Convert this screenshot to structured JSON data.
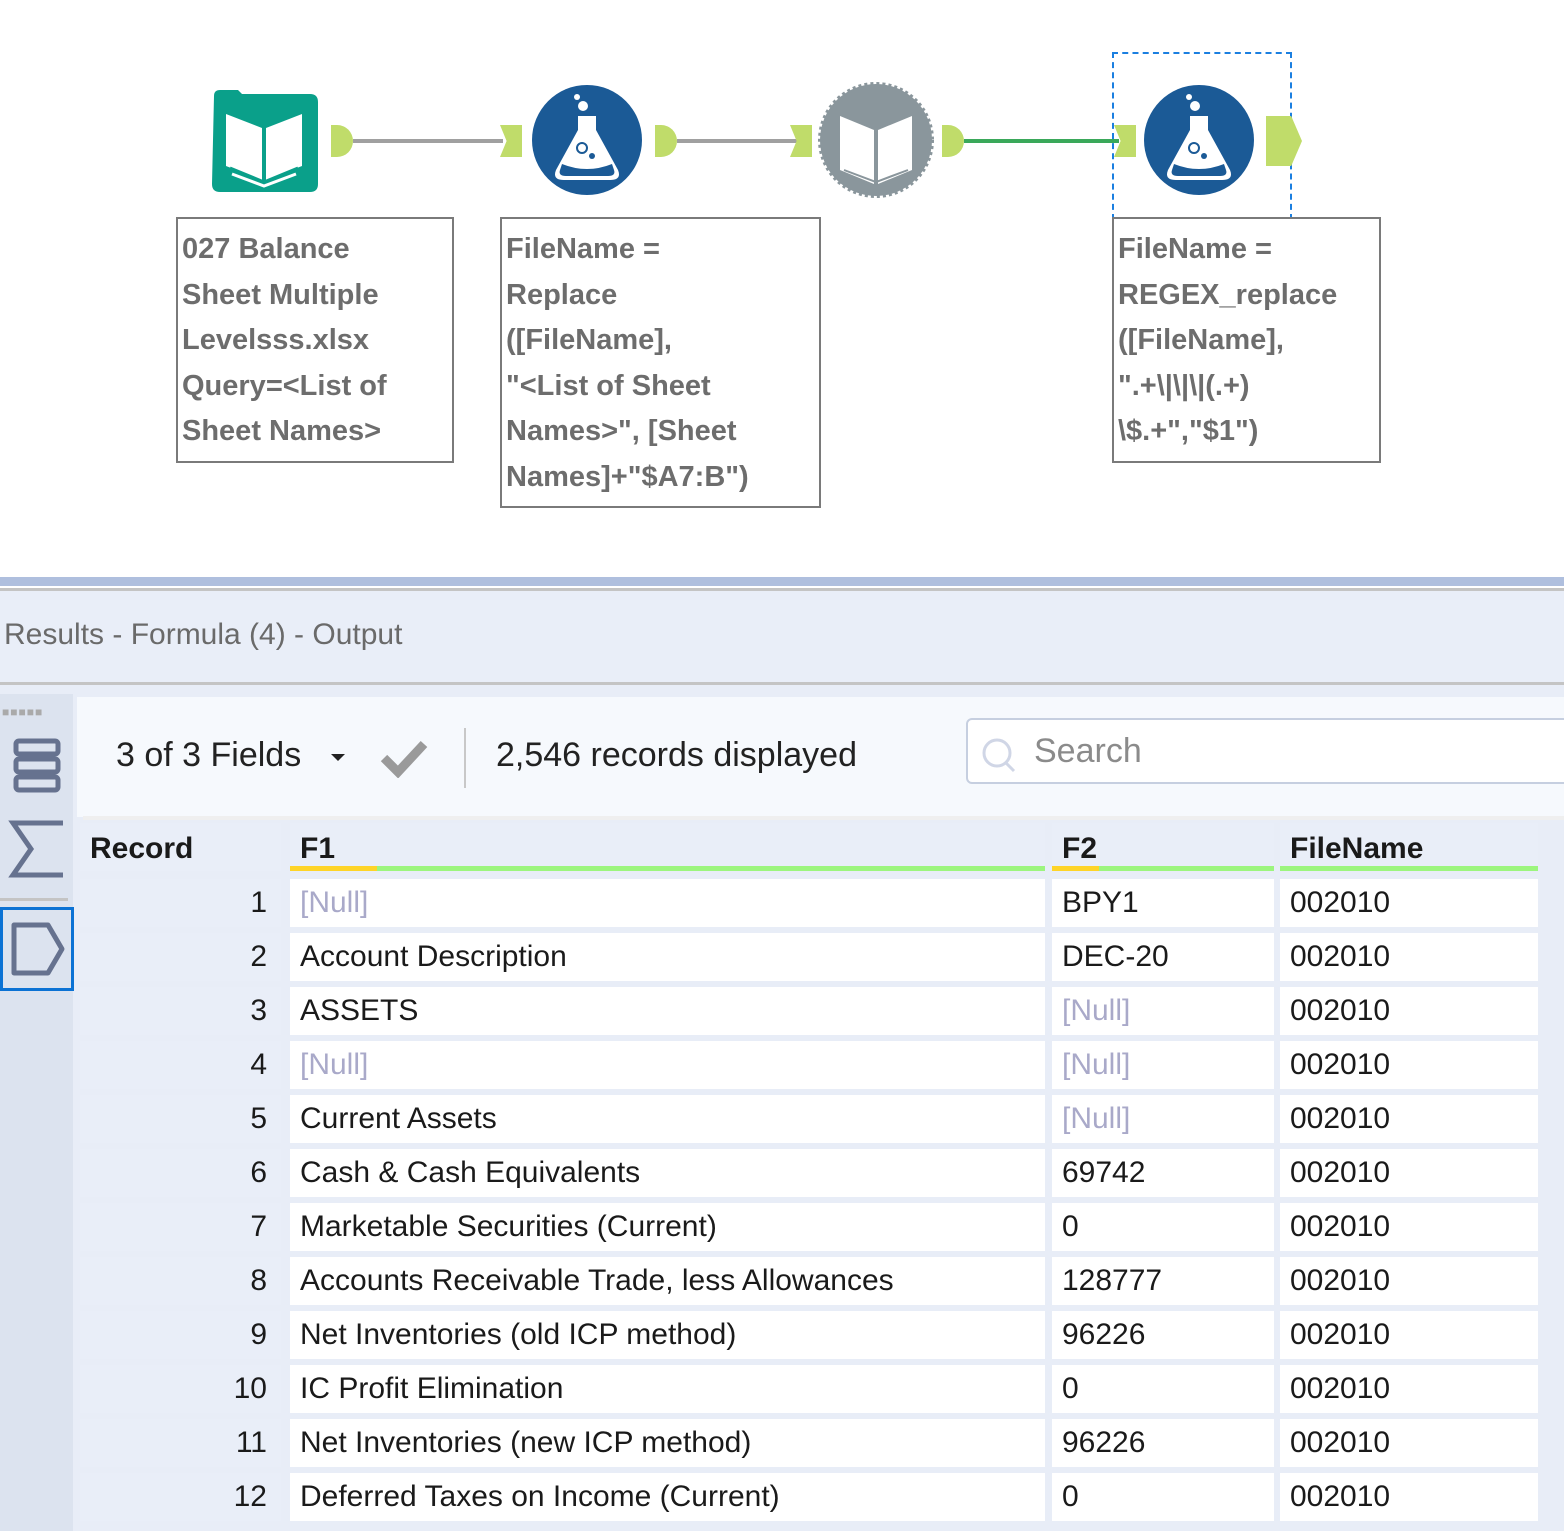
{
  "canvas": {
    "tools": [
      {
        "name": "input-data-tool",
        "icon": "input-data-book-icon",
        "color": "#0aa08a"
      },
      {
        "name": "formula-tool-1",
        "icon": "formula-flask-icon",
        "color": "#1b5a96"
      },
      {
        "name": "dynamic-input-tool",
        "icon": "dynamic-input-gear-book-icon",
        "color": "#8a969c"
      },
      {
        "name": "formula-tool-4",
        "icon": "formula-flask-icon",
        "color": "#1b5a96",
        "selected": true
      }
    ],
    "annotations": {
      "input": "027 Balance\nSheet Multiple\nLevelsss.xlsx\nQuery=<List of\nSheet Names>",
      "formula1": "FileName =\nReplace\n([FileName],\n\"<List of Sheet\nNames>\", [Sheet\nNames]+\"$A7:B\")",
      "formula4": "FileName =\nREGEX_replace\n([FileName],\n\".+\\|\\|\\|(.+)\n\\$.+\",\"$1\")"
    },
    "colors": {
      "anchor": "#c0dc6a",
      "connection": "#a0a0a0",
      "connection_active": "#3aa85a",
      "selection": "#1b7fe0"
    }
  },
  "results": {
    "title": "Results - Formula (4) - Output",
    "side_rail": [
      {
        "name": "table-view-icon"
      },
      {
        "name": "summary-sigma-icon"
      },
      {
        "name": "output-anchor-icon",
        "active": true
      }
    ],
    "toolbar": {
      "fields_label": "3 of 3 Fields",
      "records_label": "2,546 records displayed",
      "search_placeholder": "Search"
    },
    "table": {
      "columns": [
        {
          "key": "record",
          "label": "Record"
        },
        {
          "key": "f1",
          "label": "F1",
          "quality": {
            "null_fraction": 0.07
          }
        },
        {
          "key": "f2",
          "label": "F2",
          "quality": {
            "null_fraction": 0.17
          }
        },
        {
          "key": "filename",
          "label": "FileName",
          "quality": {
            "null_fraction": 0
          }
        }
      ],
      "rows": [
        {
          "record": "1",
          "f1": "[Null]",
          "f2": "BPY1",
          "filename": "002010"
        },
        {
          "record": "2",
          "f1": "Account Description",
          "f2": "DEC-20",
          "filename": "002010"
        },
        {
          "record": "3",
          "f1": "ASSETS",
          "f2": "[Null]",
          "filename": "002010"
        },
        {
          "record": "4",
          "f1": "[Null]",
          "f2": "[Null]",
          "filename": "002010"
        },
        {
          "record": "5",
          "f1": "Current Assets",
          "f2": "[Null]",
          "filename": "002010"
        },
        {
          "record": "6",
          "f1": "Cash & Cash Equivalents",
          "f2": "69742",
          "filename": "002010"
        },
        {
          "record": "7",
          "f1": "Marketable Securities (Current)",
          "f2": "0",
          "filename": "002010"
        },
        {
          "record": "8",
          "f1": "Accounts Receivable Trade, less Allowances",
          "f2": "128777",
          "filename": "002010"
        },
        {
          "record": "9",
          "f1": "Net Inventories (old ICP method)",
          "f2": "96226",
          "filename": "002010"
        },
        {
          "record": "10",
          "f1": "IC Profit Elimination",
          "f2": "0",
          "filename": "002010"
        },
        {
          "record": "11",
          "f1": "Net Inventories (new ICP method)",
          "f2": "96226",
          "filename": "002010"
        },
        {
          "record": "12",
          "f1": "Deferred Taxes on Income (Current)",
          "f2": "0",
          "filename": "002010"
        }
      ]
    }
  }
}
